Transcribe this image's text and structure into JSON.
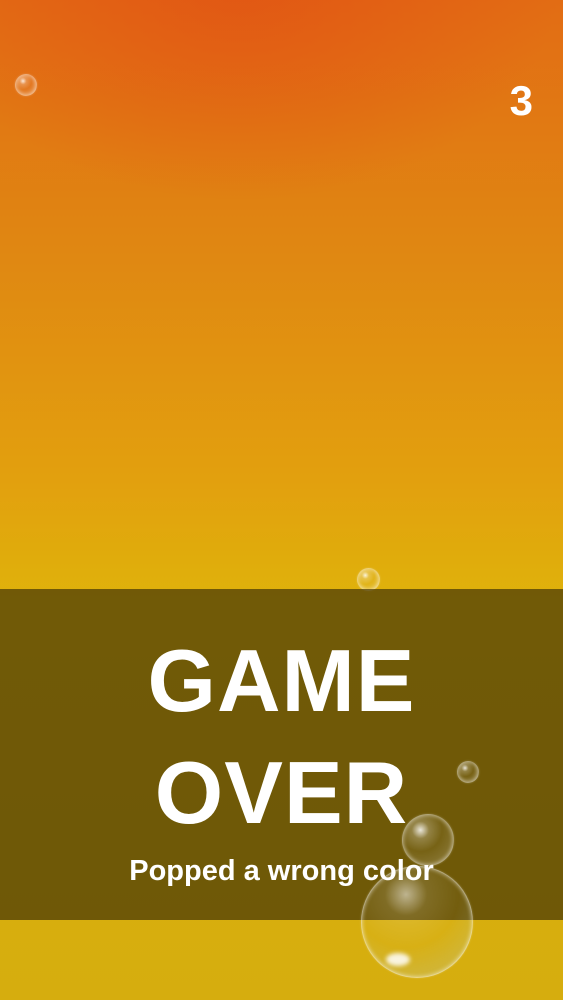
{
  "game": {
    "score": "3",
    "title_line_1": "GAME",
    "title_line_2": "OVER",
    "message": "Popped a wrong color"
  },
  "colors": {
    "background_top": "#e26c14",
    "background_bottom": "#d6ad0e",
    "overlay": "#463705",
    "text": "#ffffff"
  }
}
